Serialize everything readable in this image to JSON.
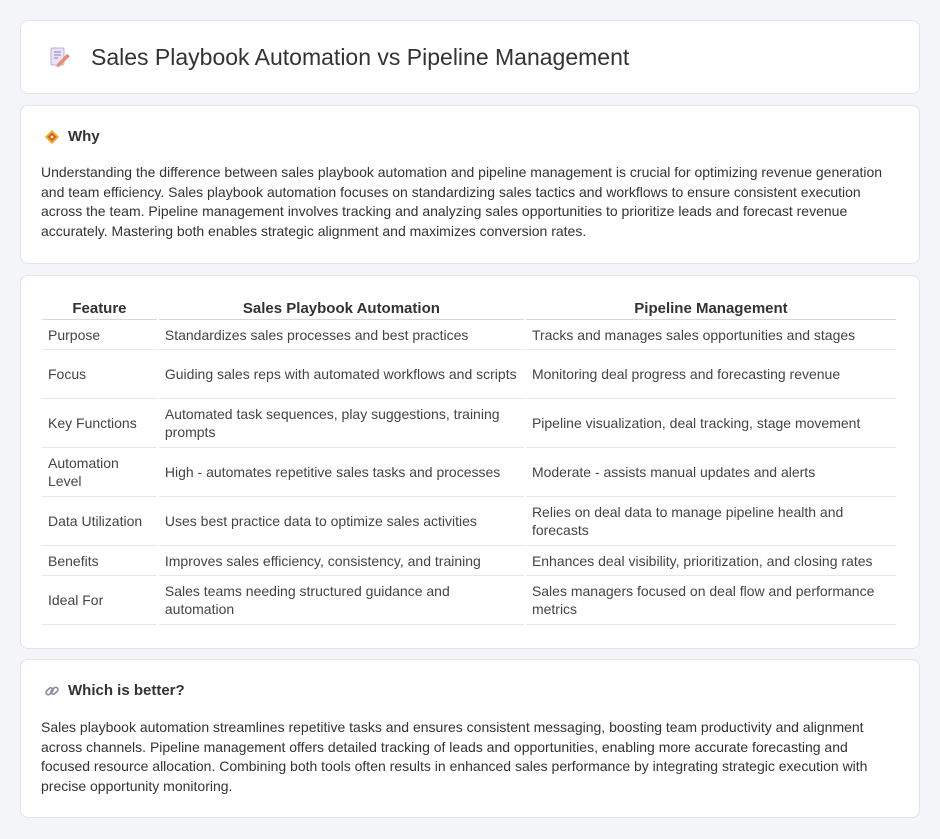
{
  "header": {
    "title": "Sales Playbook Automation vs Pipeline Management"
  },
  "why": {
    "heading": "Why",
    "text": "Understanding the difference between sales playbook automation and pipeline management is crucial for optimizing revenue generation and team efficiency. Sales playbook automation focuses on standardizing sales tactics and workflows to ensure consistent execution across the team. Pipeline management involves tracking and analyzing sales opportunities to prioritize leads and forecast revenue accurately. Mastering both enables strategic alignment and maximizes conversion rates."
  },
  "table": {
    "headers": [
      "Feature",
      "Sales Playbook Automation",
      "Pipeline Management"
    ],
    "rows": [
      [
        "Purpose",
        "Standardizes sales processes and best practices",
        "Tracks and manages sales opportunities and stages"
      ],
      [
        "Focus",
        "Guiding sales reps with automated workflows and scripts",
        "Monitoring deal progress and forecasting revenue"
      ],
      [
        "Key Functions",
        "Automated task sequences, play suggestions, training prompts",
        "Pipeline visualization, deal tracking, stage movement"
      ],
      [
        "Automation Level",
        "High - automates repetitive sales tasks and processes",
        "Moderate - assists manual updates and alerts"
      ],
      [
        "Data Utilization",
        "Uses best practice data to optimize sales activities",
        "Relies on deal data to manage pipeline health and forecasts"
      ],
      [
        "Benefits",
        "Improves sales efficiency, consistency, and training",
        "Enhances deal visibility, prioritization, and closing rates"
      ],
      [
        "Ideal For",
        "Sales teams needing structured guidance and automation",
        "Sales managers focused on deal flow and performance metrics"
      ]
    ]
  },
  "which": {
    "heading": "Which is better?",
    "text": "Sales playbook automation streamlines repetitive tasks and ensures consistent messaging, boosting team productivity and alignment across channels. Pipeline management offers detailed tracking of leads and opportunities, enabling more accurate forecasting and focused resource allocation. Combining both tools often results in enhanced sales performance by integrating strategic execution with precise opportunity monitoring."
  },
  "icons": {
    "title": "document-pencil-icon",
    "why": "diamond-sign-icon",
    "which": "link-icon"
  },
  "colors": {
    "background": "#f4f5f9",
    "card": "#ffffff",
    "text": "#333333",
    "accent_orange": "#f5a623"
  }
}
